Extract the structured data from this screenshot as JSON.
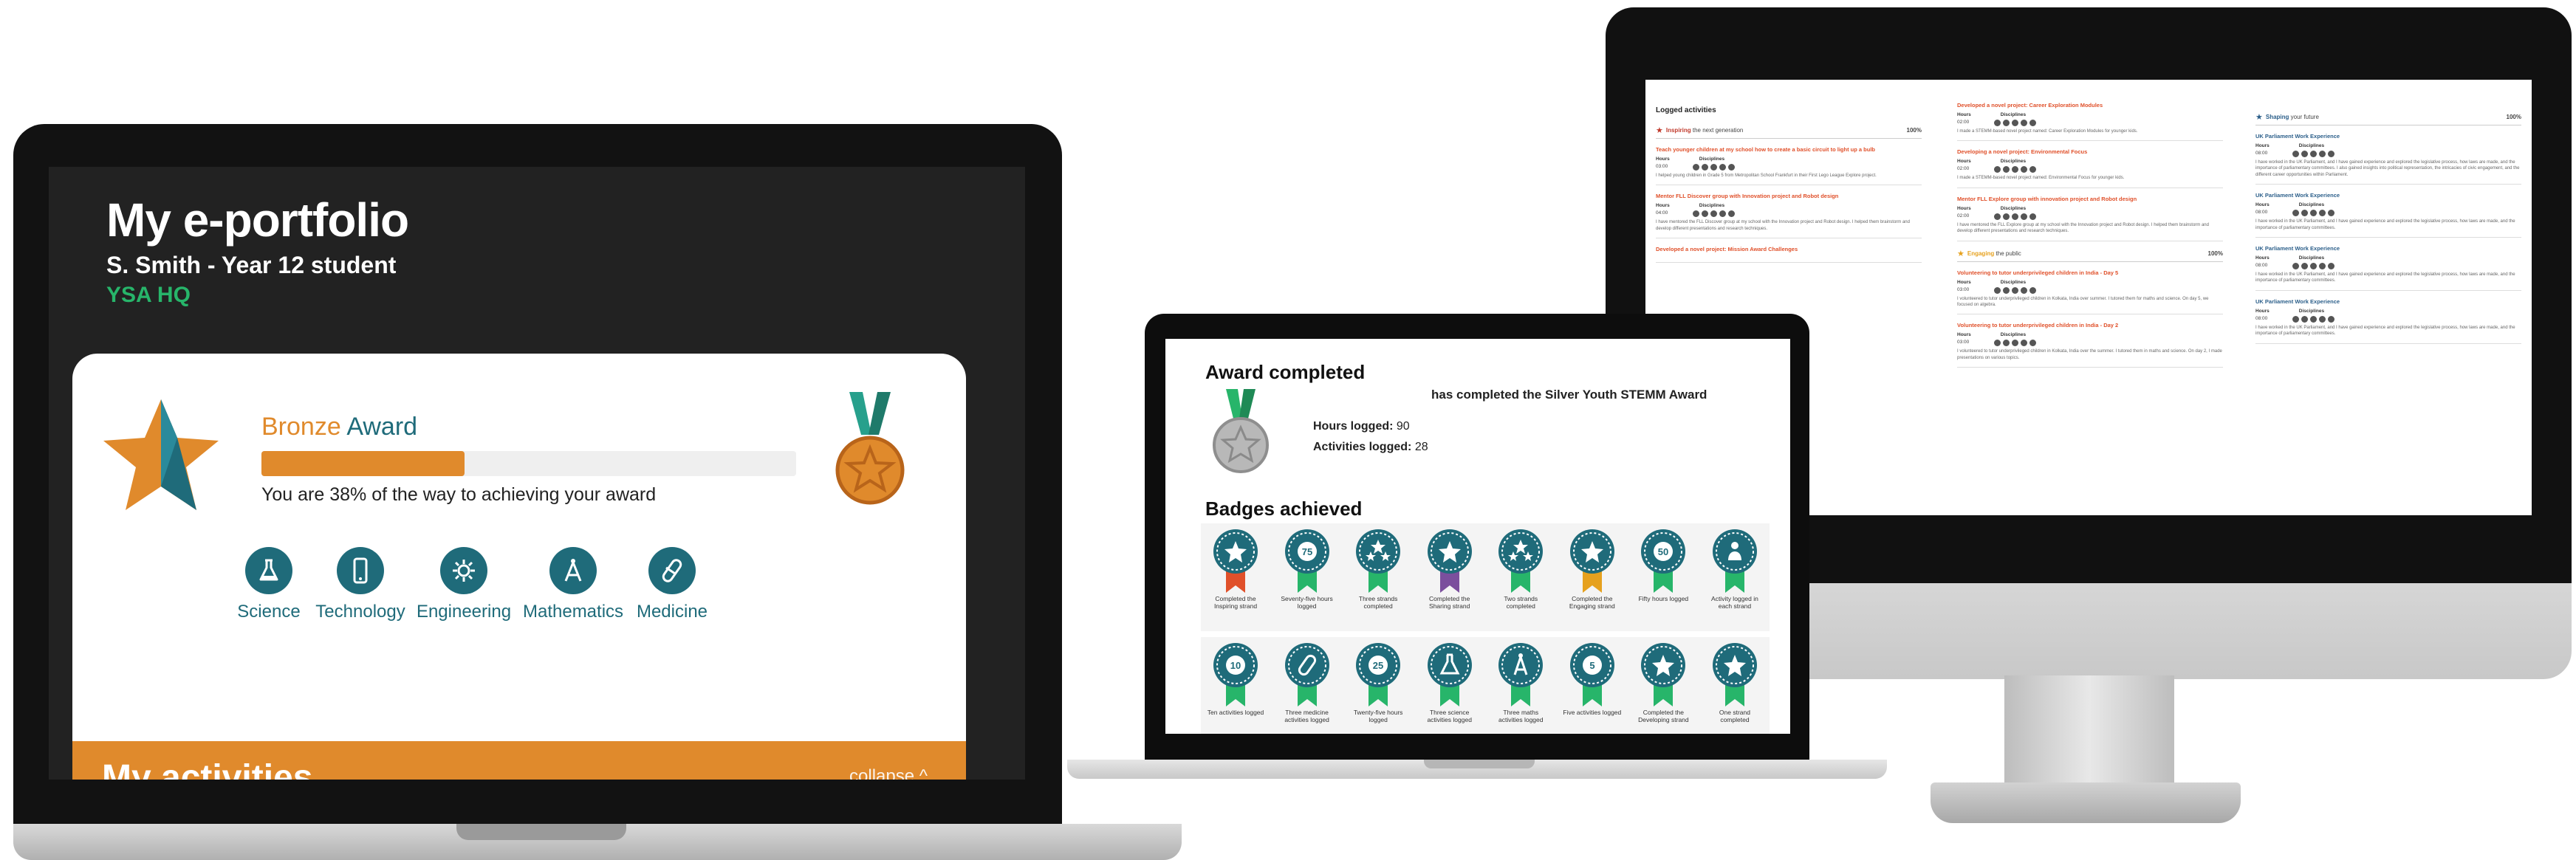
{
  "colors": {
    "teal": "#1f6b7a",
    "bronze": "#e08a2c",
    "green": "#27b56a",
    "dark": "#222222"
  },
  "eportfolio": {
    "title": "My e-portfolio",
    "student": "S. Smith - Year 12 student",
    "org": "YSA HQ",
    "award": {
      "name_part1": "Bronze",
      "name_part2": "Award",
      "progress_percent": 38,
      "progress_text": "You are 38% of the way to achieving your award"
    },
    "disciplines": [
      {
        "label": "Science",
        "icon": "flask-icon"
      },
      {
        "label": "Technology",
        "icon": "phone-icon"
      },
      {
        "label": "Engineering",
        "icon": "gear-icon"
      },
      {
        "label": "Mathematics",
        "icon": "compass-icon"
      },
      {
        "label": "Medicine",
        "icon": "pill-icon"
      }
    ],
    "activities": {
      "title": "My activities",
      "collapse_label": "collapse ^"
    }
  },
  "award_completed": {
    "title": "Award completed",
    "completed_text": "has completed the Silver Youth STEMM Award",
    "hours_label": "Hours logged:",
    "hours_value": "90",
    "activities_label": "Activities logged:",
    "activities_value": "28",
    "badges_title": "Badges achieved",
    "badges_row1": [
      {
        "caption": "Completed the Inspiring strand",
        "ribbon": "#e0502a",
        "glyph": "star"
      },
      {
        "caption": "Seventy-five hours logged",
        "ribbon": "#27b56a",
        "glyph": "75"
      },
      {
        "caption": "Three strands completed",
        "ribbon": "#27b56a",
        "glyph": "stars"
      },
      {
        "caption": "Completed the Sharing strand",
        "ribbon": "#7b4f9d",
        "glyph": "star"
      },
      {
        "caption": "Two strands completed",
        "ribbon": "#27b56a",
        "glyph": "stars"
      },
      {
        "caption": "Completed the Engaging strand",
        "ribbon": "#e6a11e",
        "glyph": "star"
      },
      {
        "caption": "Fifty hours logged",
        "ribbon": "#27b56a",
        "glyph": "50"
      },
      {
        "caption": "Activity logged in each strand",
        "ribbon": "#27b56a",
        "glyph": "person"
      }
    ],
    "badges_row2": [
      {
        "caption": "Ten activities logged",
        "ribbon": "#27b56a",
        "glyph": "10"
      },
      {
        "caption": "Three medicine activities logged",
        "ribbon": "#27b56a",
        "glyph": "pill"
      },
      {
        "caption": "Twenty-five hours logged",
        "ribbon": "#27b56a",
        "glyph": "25"
      },
      {
        "caption": "Three science activities logged",
        "ribbon": "#27b56a",
        "glyph": "flask"
      },
      {
        "caption": "Three maths activities logged",
        "ribbon": "#27b56a",
        "glyph": "compass"
      },
      {
        "caption": "Five activities logged",
        "ribbon": "#27b56a",
        "glyph": "5"
      },
      {
        "caption": "Completed the Developing strand",
        "ribbon": "#27b56a",
        "glyph": "star"
      },
      {
        "caption": "One strand completed",
        "ribbon": "#27b56a",
        "glyph": "star"
      }
    ]
  },
  "logged": {
    "title": "Logged activities",
    "col1": {
      "strand_word": "Inspiring",
      "strand_rest": "the next generation",
      "percent": "100%",
      "items": [
        {
          "title": "Teach younger children at my school how to create a basic circuit to light up a bulb",
          "hours": "03:00",
          "desc": "I helped young children in Grade 5 from Metropolitan School Frankfurt in their First Lego League Explore project."
        },
        {
          "title": "Mentor FLL Discover group with Innovation project and Robot design",
          "hours": "04:00",
          "desc": "I have mentored the FLL Discover group at my school with the Innovation project and Robot design. I helped them brainstorm and develop different presentations and research techniques."
        },
        {
          "title": "Developed a novel project: Mission Award Challenges",
          "hours": "",
          "desc": ""
        }
      ]
    },
    "col2": {
      "items": [
        {
          "title": "Developed a novel project: Career Exploration Modules",
          "hours": "02:00",
          "desc": "I made a STEMM-based novel project named: Career Exploration Modules for younger kids."
        },
        {
          "title": "Developing a novel project: Environmental Focus",
          "hours": "02:00",
          "desc": "I made a STEMM-based novel project named: Environmental Focus for younger kids."
        },
        {
          "title": "Mentor FLL Explore group with innovation project and Robot design",
          "hours": "02:00",
          "desc": "I have mentored the FLL Explore group at my school with the Innovation project and Robot design. I helped them brainstorm and develop different presentations and research techniques."
        }
      ],
      "strand_word": "Engaging",
      "strand_rest": "the public",
      "percent": "100%",
      "items2": [
        {
          "title": "Volunteering to tutor underprivileged children in India - Day 5",
          "hours": "03:00",
          "desc": "I volunteered to tutor underprivileged children in Kolkata, India over summer. I tutored them for maths and science. On day 5, we focused on algebra."
        },
        {
          "title": "Volunteering to tutor underprivileged children in India - Day 2",
          "hours": "03:00",
          "desc": "I volunteered to tutor underprivileged children in Kolkata, India over the summer. I tutored them in maths and science. On day 2, I made presentations on various topics."
        }
      ]
    },
    "col3": {
      "strand_word": "Shaping",
      "strand_rest": "your future",
      "percent": "100%",
      "items": [
        {
          "title": "UK Parliament Work Experience",
          "hours": "08:00",
          "desc": "I have worked in the UK Parliament, and I have gained experience and explored the legislative process, how laws are made, and the importance of parliamentary committees. I also gained insights into political representation, the intricacies of civic engagement, and the different career opportunities within Parliament."
        },
        {
          "title": "UK Parliament Work Experience",
          "hours": "08:00",
          "desc": "I have worked in the UK Parliament, and I have gained experience and explored the legislative process, how laws are made, and the importance of parliamentary committees."
        },
        {
          "title": "UK Parliament Work Experience",
          "hours": "08:00",
          "desc": "I have worked in the UK Parliament, and I have gained experience and explored the legislative process, how laws are made, and the importance of parliamentary committees."
        },
        {
          "title": "UK Parliament Work Experience",
          "hours": "08:00",
          "desc": "I have worked in the UK Parliament, and I have gained experience and explored the legislative process, how laws are made, and the importance of parliamentary committees."
        }
      ]
    },
    "labels": {
      "hours": "Hours",
      "disciplines": "Disciplines"
    }
  }
}
